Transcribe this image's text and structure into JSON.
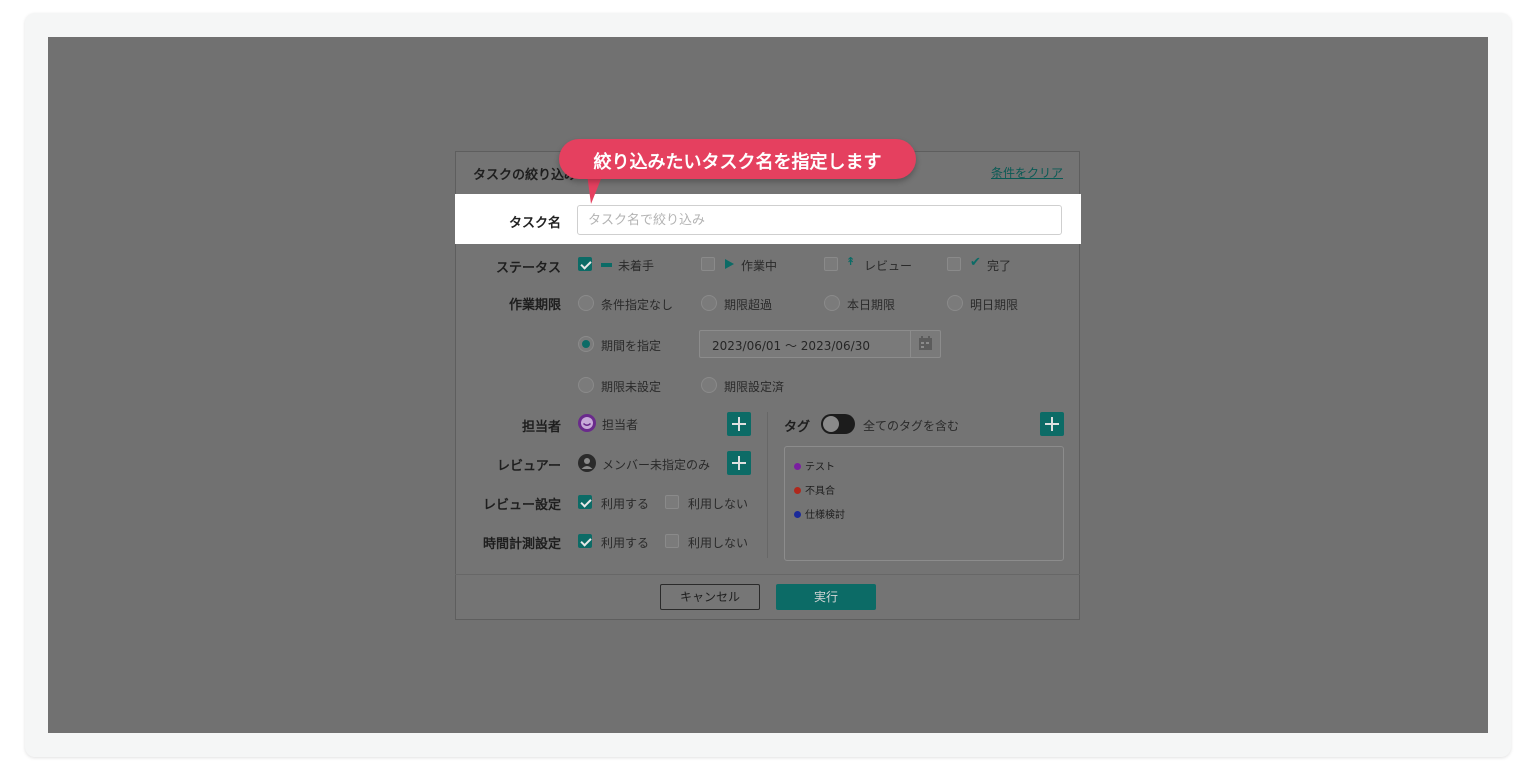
{
  "dialog": {
    "title": "タスクの絞り込み",
    "clear_link": "条件をクリア"
  },
  "callout": {
    "text": "絞り込みたいタスク名を指定します"
  },
  "task_name": {
    "label": "タスク名",
    "placeholder": "タスク名で絞り込み",
    "value": ""
  },
  "status": {
    "label": "ステータス",
    "options": [
      {
        "label": "未着手",
        "checked": true,
        "icon": "minus-icon"
      },
      {
        "label": "作業中",
        "checked": false,
        "icon": "play-icon"
      },
      {
        "label": "レビュー",
        "checked": false,
        "icon": "review-icon"
      },
      {
        "label": "完了",
        "checked": false,
        "icon": "check-icon"
      }
    ]
  },
  "deadline": {
    "label": "作業期限",
    "options": [
      {
        "label": "条件指定なし",
        "selected": false
      },
      {
        "label": "期限超過",
        "selected": false
      },
      {
        "label": "本日期限",
        "selected": false
      },
      {
        "label": "明日期限",
        "selected": false
      },
      {
        "label": "期間を指定",
        "selected": true
      },
      {
        "label": "期限未設定",
        "selected": false
      },
      {
        "label": "期限設定済",
        "selected": false
      }
    ],
    "date_range": "2023/06/01 〜 2023/06/30"
  },
  "assignee": {
    "label": "担当者",
    "value": "担当者"
  },
  "reviewer": {
    "label": "レビュアー",
    "value": "メンバー未指定のみ"
  },
  "review_setting": {
    "label": "レビュー設定",
    "use": "利用する",
    "use_checked": true,
    "not_use": "利用しない",
    "not_use_checked": false
  },
  "time_setting": {
    "label": "時間計測設定",
    "use": "利用する",
    "use_checked": true,
    "not_use": "利用しない",
    "not_use_checked": false
  },
  "tags": {
    "label": "タグ",
    "toggle_label": "全てのタグを含む",
    "toggle_on": false,
    "items": [
      {
        "label": "テスト",
        "color": "#7a1fa0"
      },
      {
        "label": "不具合",
        "color": "#b0281c"
      },
      {
        "label": "仕様検討",
        "color": "#1b2a9a"
      }
    ]
  },
  "footer": {
    "cancel": "キャンセル",
    "execute": "実行"
  },
  "colors": {
    "accent": "#0c6b66",
    "callout": "#e5405f",
    "overlay": "#717171"
  }
}
